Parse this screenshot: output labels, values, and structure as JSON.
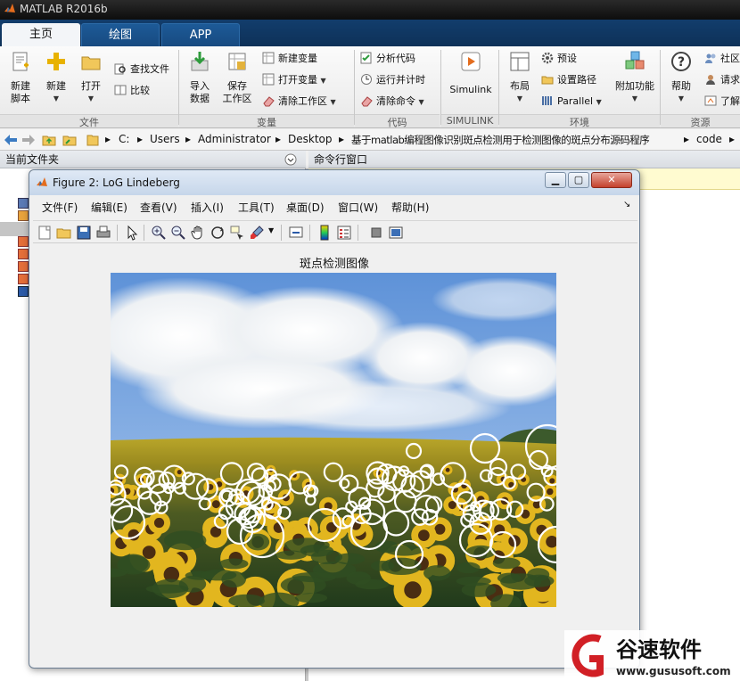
{
  "app": {
    "title": "MATLAB R2016b"
  },
  "tabs": [
    {
      "label": "主页",
      "active": true
    },
    {
      "label": "绘图"
    },
    {
      "label": "APP"
    }
  ],
  "ribbon": {
    "file": {
      "label": "文件",
      "new_script": "新建\n脚本",
      "new": "新建",
      "open": "打开",
      "find_files": "查找文件",
      "compare": "比较"
    },
    "variable": {
      "label": "变量",
      "import_data": "导入\n数据",
      "save_workspace": "保存\n工作区",
      "new_variable": "新建变量",
      "open_variable": "打开变量",
      "clear_workspace": "清除工作区"
    },
    "code": {
      "label": "代码",
      "analyze_code": "分析代码",
      "run_and_time": "运行并计时",
      "clear_commands": "清除命令"
    },
    "simulink": {
      "label": "SIMULINK",
      "button": "Simulink"
    },
    "environment": {
      "label": "环境",
      "layout": "布局",
      "preferences": "预设",
      "set_path": "设置路径",
      "parallel": "Parallel",
      "addons": "附加功能"
    },
    "resources": {
      "label": "资源",
      "help": "帮助",
      "community": "社区",
      "request_support": "请求",
      "learn": "了解"
    }
  },
  "address": {
    "crumbs": [
      "C:",
      "Users",
      "Administrator",
      "Desktop",
      "基于matlab编程图像识别斑点检测用于检测图像的斑点分布源码程序",
      "code"
    ]
  },
  "panes": {
    "current_folder": "当前文件夹",
    "command_window": "命令行窗口"
  },
  "figure": {
    "title": "Figure 2: LoG Lindeberg",
    "menu": [
      "文件(F)",
      "编辑(E)",
      "查看(V)",
      "插入(I)",
      "工具(T)",
      "桌面(D)",
      "窗口(W)",
      "帮助(H)"
    ],
    "axes_title": "斑点检测图像",
    "image_description": "sunflower field with sky and clouds, white circles mark detected blobs"
  },
  "colors": {
    "tabbar": "#123d6c",
    "figure_bg": "#f0f0f0",
    "blob_circle": "#ffffff"
  },
  "watermark": {
    "brand": "谷速软件",
    "url": "www.gususoft.com"
  }
}
